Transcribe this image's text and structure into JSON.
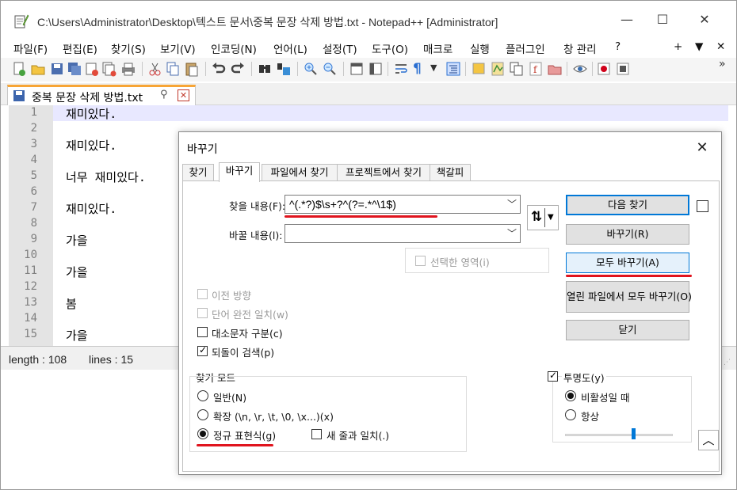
{
  "window": {
    "title": "C:\\Users\\Administrator\\Desktop\\텍스트 문서\\중복 문장 삭제 방법.txt - Notepad++ [Administrator]",
    "minimize": "—",
    "maximize": "☐",
    "close": "✕"
  },
  "menu": {
    "items": [
      "파일(F)",
      "편집(E)",
      "찾기(S)",
      "보기(V)",
      "인코딩(N)",
      "언어(L)",
      "설정(T)",
      "도구(O)",
      "매크로",
      "실행",
      "플러그인",
      "창 관리",
      "?"
    ],
    "right": [
      "+",
      "▼",
      "✕"
    ]
  },
  "tab": {
    "label": "중복 문장 삭제 방법.txt",
    "pin": "📌",
    "close": "✕"
  },
  "editor": {
    "line_numbers": [
      "1",
      "2",
      "3",
      "4",
      "5",
      "6",
      "7",
      "8",
      "9",
      "10",
      "11",
      "12",
      "13",
      "14",
      "15"
    ],
    "lines": [
      "재미있다.",
      "",
      "재미있다.",
      "",
      "너무 재미있다.",
      "",
      "재미있다.",
      "",
      "가을",
      "",
      "가을",
      "",
      "봄",
      "",
      "가을"
    ]
  },
  "status": {
    "length": "length : 108",
    "lines": "lines : 15"
  },
  "dialog": {
    "title": "바꾸기",
    "close": "✕",
    "tabs": [
      "찾기",
      "바꾸기",
      "파일에서 찾기",
      "프로젝트에서 찾기",
      "책갈피"
    ],
    "active_tab": "바꾸기",
    "find_label": "찾을 내용(F):",
    "find_value": "^(.*?)$\\s+?^(?=.*^\\1$)",
    "replace_label": "바꿀 내용(l):",
    "replace_value": "",
    "swap_icon": "⇅",
    "in_selection": "선택한 영역(i)",
    "buttons": {
      "find_next": "다음 찾기",
      "replace": "바꾸기(R)",
      "replace_all": "모두 바꾸기(A)",
      "replace_all_open": "열린 파일에서 모두 바꾸기(O)",
      "close": "닫기",
      "collapse": "^"
    },
    "options": {
      "backward": "이전 방향",
      "whole_word": "단어 완전 일치(w)",
      "match_case": "대소문자 구분(c)",
      "wrap": "되돌이 검색(p)"
    },
    "search_mode": {
      "title": "찾기 모드",
      "normal": "일반(N)",
      "extended": "확장 (\\n, \\r, \\t, \\0, \\x...)(x)",
      "regex": "정규 표현식(g)",
      "dot_newline": "새 줄과 일치(.)"
    },
    "transparency": {
      "title": "투명도(y)",
      "on_lose_focus": "비활성일 때",
      "always": "항상",
      "slider_value": 0.63
    }
  },
  "colors": {
    "accent": "#0078d7",
    "annotation_red": "#e0141e",
    "tab_orange": "#f7a536",
    "gutter": "#e4e4e4",
    "current_line": "#e8e8ff"
  }
}
